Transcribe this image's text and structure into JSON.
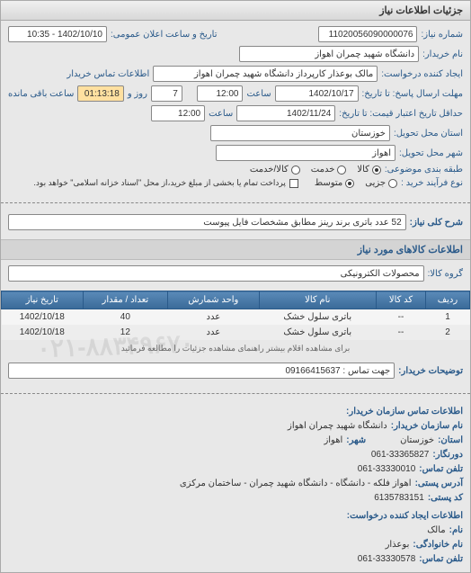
{
  "header": "جزئیات اطلاعات نیاز",
  "form": {
    "req_number_label": "شماره نیاز:",
    "req_number": "11020056090000076",
    "announce_label": "تاریخ و ساعت اعلان عمومی:",
    "announce_value": "1402/10/10 - 10:35",
    "buyer_name_label": "نام خریدار:",
    "buyer_name": "دانشگاه شهید چمران اهواز",
    "creator_label": "ایجاد کننده درخواست:",
    "creator": "مالک بوعذار کارپرداز دانشگاه شهید چمران اهواز",
    "buyer_contact_label": "اطلاعات تماس خریدار",
    "response_deadline_label": "مهلت ارسال پاسخ: تا تاریخ:",
    "response_date": "1402/10/17",
    "time_label": "ساعت",
    "response_time": "12:00",
    "remaining_label": "روز و",
    "remaining_days": "7",
    "remaining_time": "01:13:18",
    "remaining_suffix": "ساعت باقی مانده",
    "validity_label": "حداقل تاریخ اعتبار قیمت: تا تاریخ:",
    "validity_date": "1402/11/24",
    "validity_time": "12:00",
    "state_label": "استان محل تحویل:",
    "state": "خوزستان",
    "city_label": "شهر محل تحویل:",
    "city": "اهواز",
    "subject_group_label": "طبقه بندی موضوعی:",
    "radio_goods": "کالا",
    "radio_service": "خدمت",
    "radio_goods_service": "کالا/خدمت",
    "buy_process_label": "نوع فرآیند خرید :",
    "radio_partial": "جزیی",
    "radio_medium": "متوسط",
    "payment_note": "پرداخت تمام یا بخشی از مبلغ خرید،از محل \"اسناد خزانه اسلامی\" خواهد بود."
  },
  "need_title": {
    "label": "شرح کلی نیاز:",
    "value": "52 عدد باتری برند رینز مطابق مشخصات فایل پیوست"
  },
  "items_header": "اطلاعات کالاهای مورد نیاز",
  "group_label": "گروه کالا:",
  "group_value": "محصولات الکترونیکی",
  "table": {
    "headers": [
      "ردیف",
      "کد کالا",
      "نام کالا",
      "واحد شمارش",
      "تعداد / مقدار",
      "تاریخ نیاز"
    ],
    "rows": [
      {
        "idx": "1",
        "code": "--",
        "name": "باتری سلول خشک",
        "unit": "عدد",
        "qty": "40",
        "date": "1402/10/18"
      },
      {
        "idx": "2",
        "code": "--",
        "name": "باتری سلول خشک",
        "unit": "عدد",
        "qty": "12",
        "date": "1402/10/18"
      }
    ]
  },
  "more_note": "برای مشاهده اقلام بیشتر راهنمای مشاهده جزئیات را مطالعه فرمائید",
  "buyer_notes_label": "توضیحات خریدار:",
  "buyer_notes": "جهت تماس : 09166415637",
  "contact": {
    "title": "اطلاعات تماس سازمان خریدار:",
    "org_name_label": "نام سازمان خریدار:",
    "org_name": "دانشگاه شهید چمران اهواز",
    "state_label": "استان:",
    "state": "خوزستان",
    "city_label": "شهر:",
    "city": "اهواز",
    "fax_label": "دورنگار:",
    "fax": "061-33365827",
    "phone_label": "تلفن تماس:",
    "phone": "061-33330010",
    "address_label": "آدرس پستی:",
    "address": "اهواز فلکه - دانشگاه - دانشگاه شهید چمران - ساختمان مرکزی",
    "postal_label": "کد پستی:",
    "postal": "6135783151",
    "creator_title": "اطلاعات ایجاد کننده درخواست:",
    "first_name_label": "نام:",
    "first_name": "مالک",
    "last_name_label": "نام خانوادگی:",
    "last_name": "بوعذار",
    "creator_phone_label": "تلفن تماس:",
    "creator_phone": "061-33330578"
  }
}
